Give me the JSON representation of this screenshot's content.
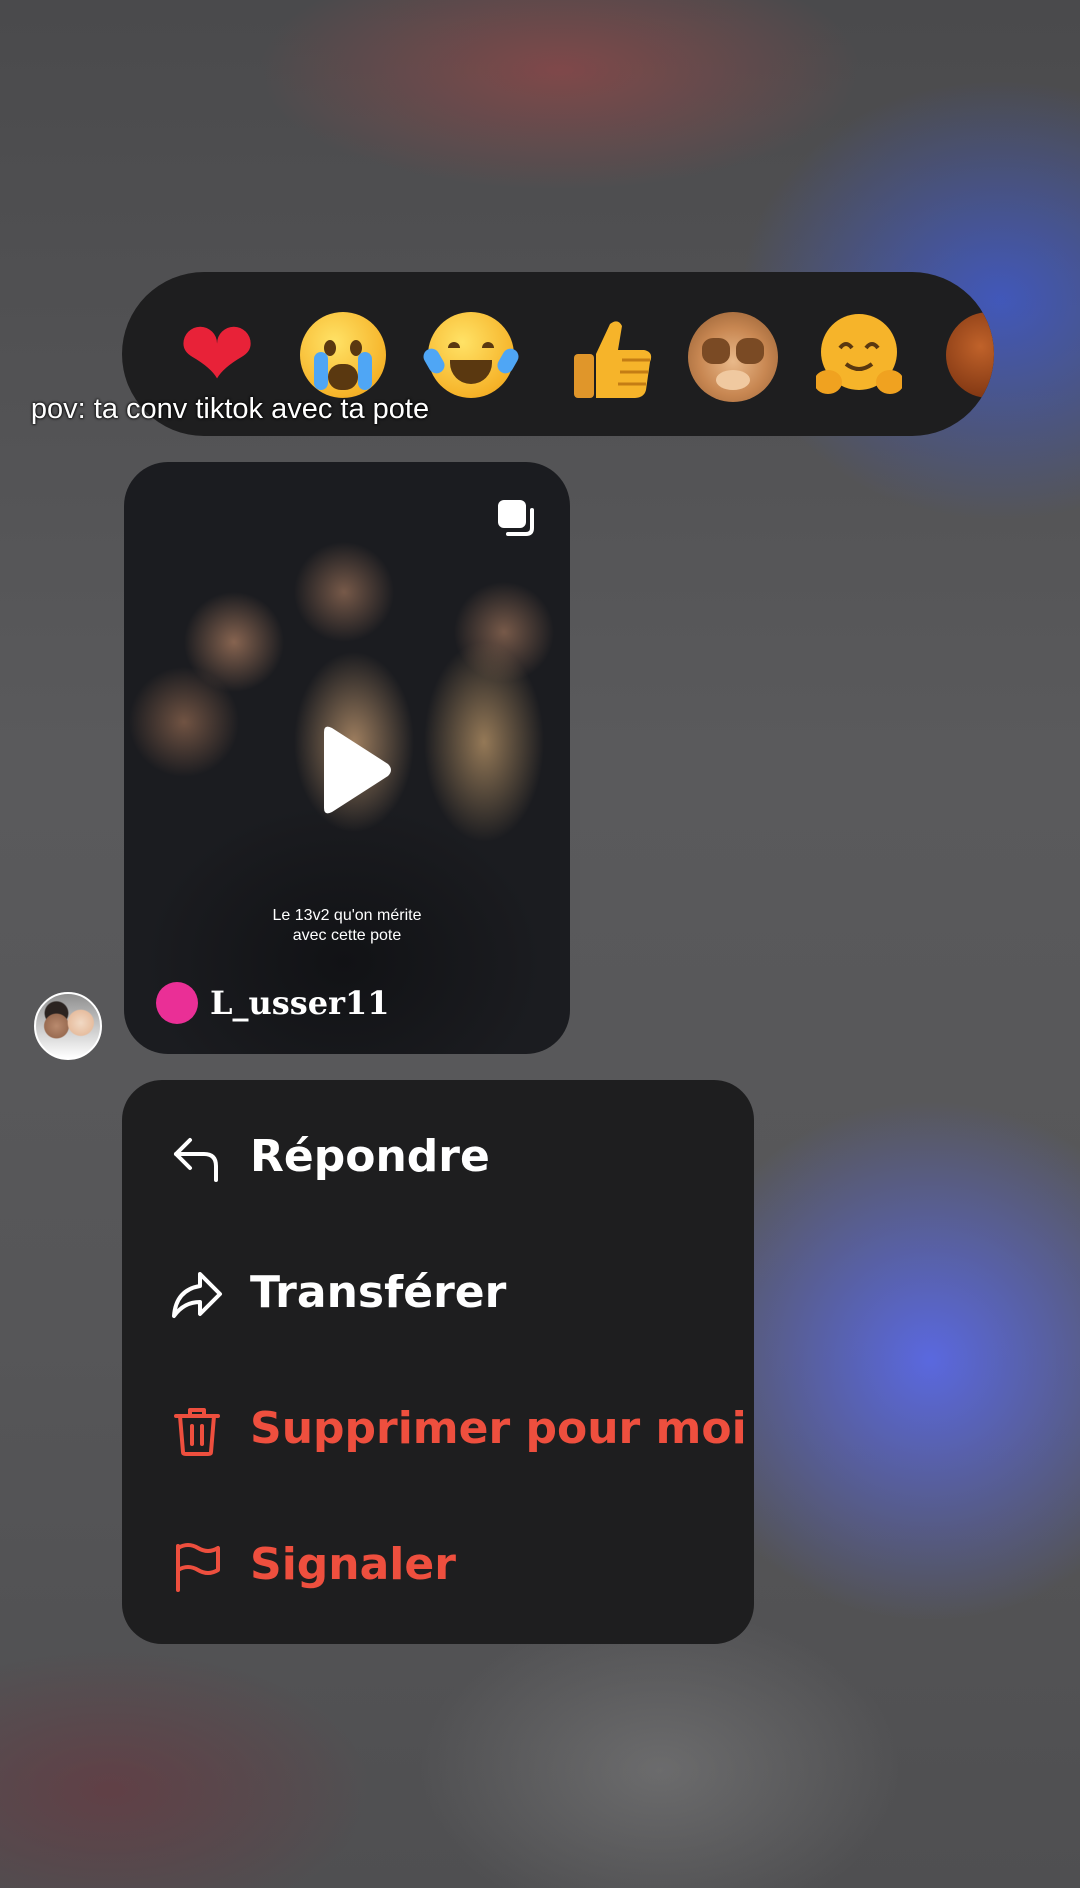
{
  "caption": "pov: ta conv tiktok avec ta pote",
  "reactions": [
    "red-heart",
    "loudly-crying-face",
    "face-with-tears-of-joy",
    "thumbs-up",
    "see-no-evil-monkey",
    "hugging-face",
    "partial-emoji"
  ],
  "video": {
    "overlay_text": "Le 13v2 qu'on mérite avec cette pote",
    "creator_name": "L_usser11",
    "creator_dot_color": "#ea2f96"
  },
  "menu": {
    "reply_label": "Répondre",
    "forward_label": "Transférer",
    "delete_label": "Supprimer pour moi",
    "report_label": "Signaler"
  },
  "colors": {
    "danger": "#ee4f3e",
    "panel": "#1e1e1f"
  }
}
